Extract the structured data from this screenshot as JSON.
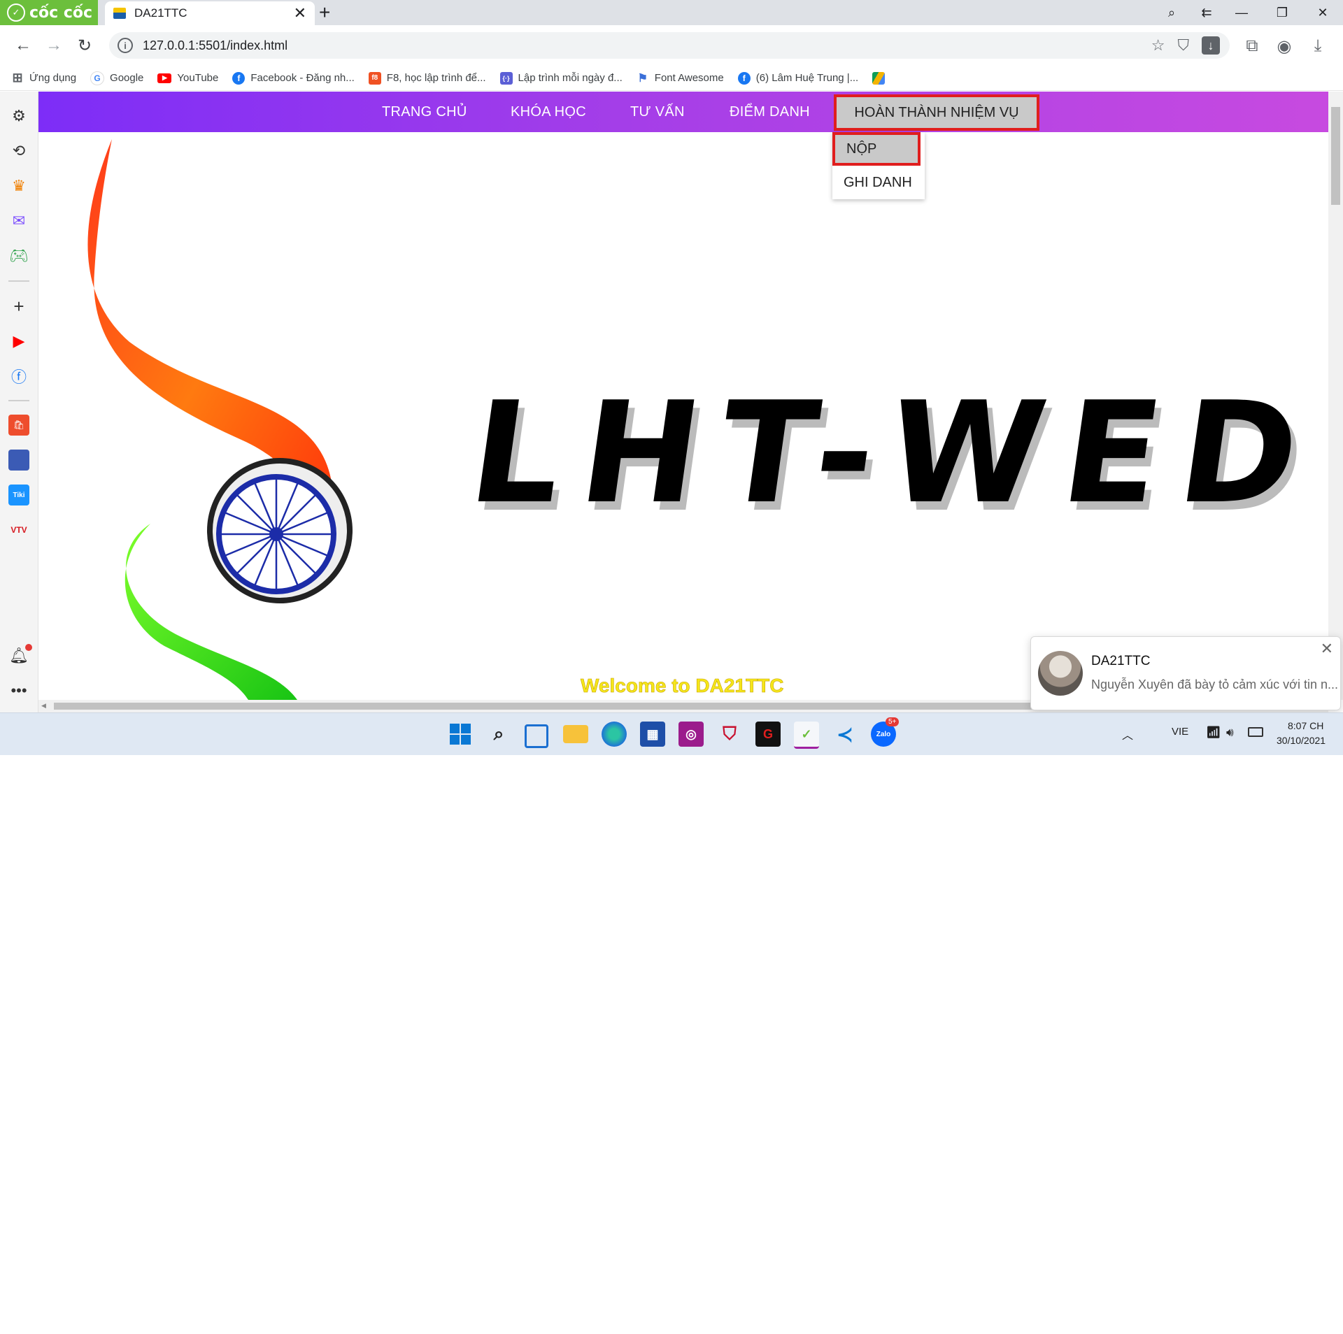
{
  "browser": {
    "brand": "cốc cốc",
    "tab_title": "DA21TTC",
    "url": "127.0.0.1:5501/index.html"
  },
  "bookmarks": [
    {
      "label": "Ứng dụng",
      "icon": "apps-grid-icon"
    },
    {
      "label": "Google",
      "icon": "google-icon"
    },
    {
      "label": "YouTube",
      "icon": "youtube-icon"
    },
    {
      "label": "Facebook - Đăng nh...",
      "icon": "facebook-icon"
    },
    {
      "label": "F8, học lập trình để...",
      "icon": "f8-icon"
    },
    {
      "label": "Lập trình mỗi ngày đ...",
      "icon": "code-icon"
    },
    {
      "label": "Font Awesome",
      "icon": "flag-icon"
    },
    {
      "label": "(6) Lâm Huệ Trung |...",
      "icon": "facebook-icon"
    }
  ],
  "site": {
    "nav": [
      {
        "label": "TRANG CHỦ"
      },
      {
        "label": "KHÓA HỌC"
      },
      {
        "label": "TƯ VẤN"
      },
      {
        "label": "ĐIỂM DANH"
      },
      {
        "label": "HOÀN THÀNH NHIỆM VỤ"
      }
    ],
    "dropdown": [
      {
        "label": "NỘP"
      },
      {
        "label": "GHI DANH"
      }
    ],
    "hero_title": "LHT-WED",
    "welcome": "Welcome to DA21TTC",
    "colors": {
      "nav_start": "#7d2df7",
      "nav_end": "#c74ae0",
      "highlight": "#e01e1e",
      "welcome": "#f5e71b"
    }
  },
  "notification": {
    "title": "DA21TTC",
    "message": "Nguyễn Xuyên đã bày tỏ cảm xúc với tin n..."
  },
  "taskbar": {
    "language": "VIE",
    "time": "8:07 CH",
    "date": "30/10/2021",
    "zalo_badge": "5+"
  }
}
